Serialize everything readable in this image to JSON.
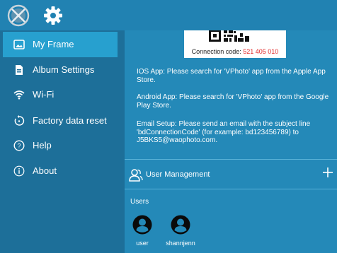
{
  "topbar": {
    "icons": [
      "close-icon",
      "gear-icon"
    ]
  },
  "sidebar": {
    "items": [
      {
        "label": "My Frame",
        "icon": "picture-icon",
        "active": true
      },
      {
        "label": "Album Settings",
        "icon": "document-icon",
        "active": false
      },
      {
        "label": "Wi-Fi",
        "icon": "wifi-icon",
        "active": false
      },
      {
        "label": "Factory data reset",
        "icon": "reset-icon",
        "active": false
      },
      {
        "label": "Help",
        "icon": "help-icon",
        "active": false
      },
      {
        "label": "About",
        "icon": "info-icon",
        "active": false
      }
    ]
  },
  "main": {
    "connection": {
      "label": "Connection code:",
      "code": "521 405 010"
    },
    "ios_text": "IOS App: Please search for 'VPhoto' app from the Apple App Store.",
    "android_text": "Android App: Please search for 'VPhoto' app from the Google Play Store.",
    "email_text": "Email Setup: Please send an email with the subject line 'bdConnectionCode' (for example: bd123456789) to J5BKS5@waophoto.com.",
    "user_management": {
      "label": "User Management"
    },
    "users_label": "Users",
    "users": [
      {
        "name": "user"
      },
      {
        "name": "shannjenn"
      }
    ]
  },
  "colors": {
    "background": "#2489b8",
    "sidebar": "#1d6f99",
    "sidebar_active": "#27a0cf",
    "topbar": "#2182b2",
    "code_highlight": "#e22a2a"
  }
}
